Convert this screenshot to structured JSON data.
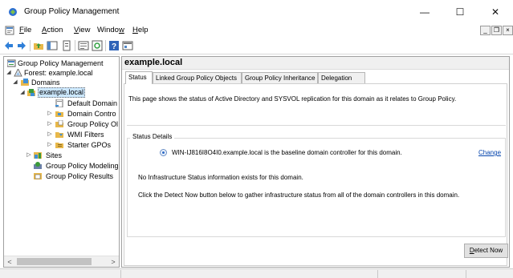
{
  "window": {
    "title": "Group Policy Management",
    "controls": {
      "minimize": "—",
      "maximize": "☐",
      "close": "✕"
    }
  },
  "menu": {
    "items": [
      {
        "underline": "F",
        "rest": "ile"
      },
      {
        "underline": "A",
        "rest": "ction"
      },
      {
        "underline": "V",
        "rest": "iew"
      },
      {
        "prefix": "Windo",
        "underline": "w",
        "rest": ""
      },
      {
        "underline": "H",
        "rest": "elp"
      }
    ],
    "mdi": {
      "minimize": "_",
      "restore": "❐",
      "close": "×"
    }
  },
  "tree": {
    "root": "Group Policy Management",
    "forest": "Forest: example.local",
    "domains": "Domains",
    "domain": "example.local",
    "default_domain": "Default Domain",
    "domain_controllers": "Domain Contro",
    "gpo_objects": "Group Policy Ol",
    "wmi_filters": "WMI Filters",
    "starter_gpos": "Starter GPOs",
    "sites": "Sites",
    "modeling": "Group Policy Modeling",
    "results": "Group Policy Results",
    "scroll_left": "<",
    "scroll_right": ">"
  },
  "details": {
    "heading": "example.local",
    "tabs": [
      "Status",
      "Linked Group Policy Objects",
      "Group Policy Inheritance",
      "Delegation"
    ],
    "intro": "This page shows the status of Active Directory and SYSVOL replication for this domain as it relates to Group Policy.",
    "group_title": "Status Details",
    "baseline": "WIN-IJ816I8O4I0.example.local is the baseline domain controller for this domain.",
    "change": "Change",
    "no_infra": "No Infrastructure Status information exists for this domain.",
    "click_detect": "Click the Detect Now button below to gather infrastructure status from all of the domain controllers in this domain.",
    "detect_underline": "D",
    "detect_rest": "etect Now"
  },
  "colors": {
    "selection": "#cce8ff",
    "link": "#0645ad",
    "folder": "#e8b84a"
  }
}
